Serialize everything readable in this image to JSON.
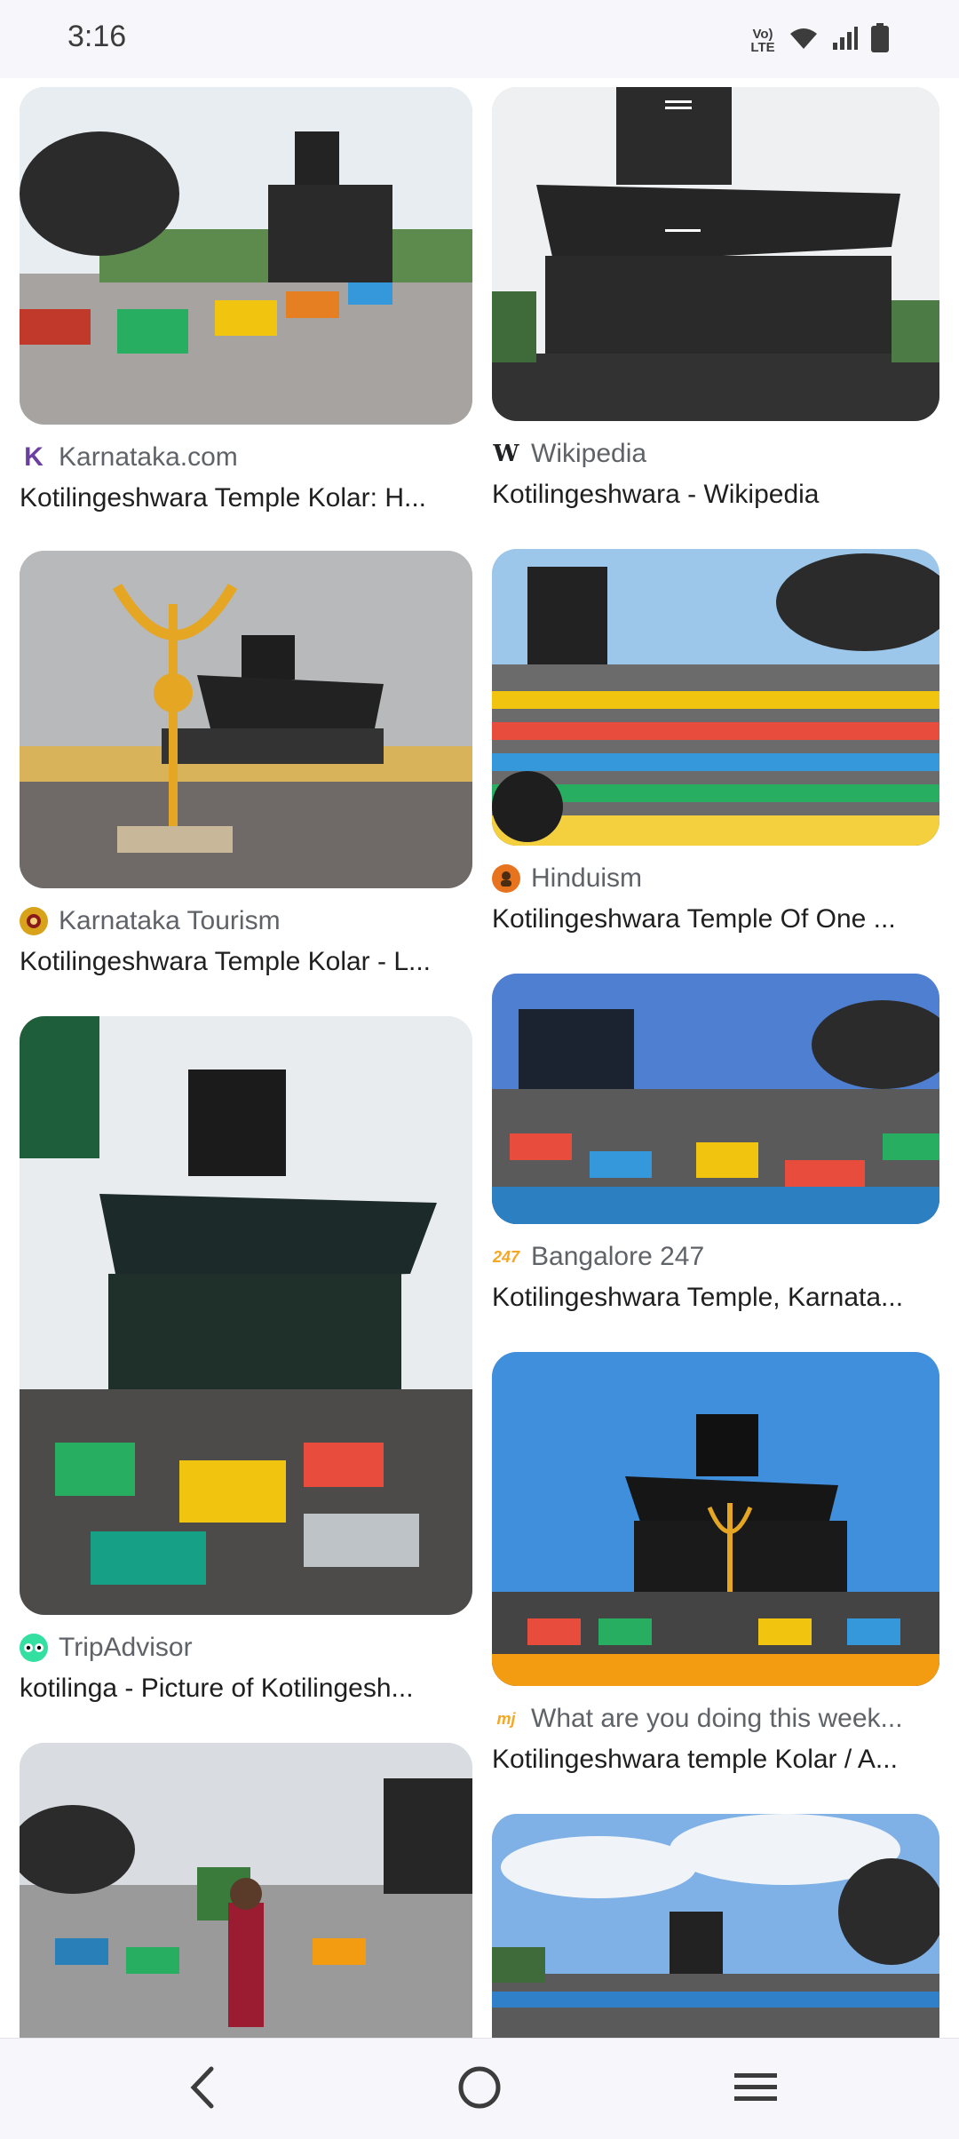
{
  "status_bar": {
    "time": "3:16",
    "volte_label": "Vo) LTE",
    "icons": [
      "volte-icon",
      "wifi-icon",
      "signal-icon",
      "battery-icon"
    ]
  },
  "results": {
    "left_column": [
      {
        "source": "Karnataka.com",
        "favicon": "K",
        "favicon_color": "#6b3fa0",
        "title": "Kotilingeshwara Temple Kolar: H..."
      },
      {
        "source": "Karnataka Tourism",
        "favicon": "emblem",
        "favicon_color": "#d9a21b",
        "title": "Kotilingeshwara Temple Kolar - L..."
      },
      {
        "source": "TripAdvisor",
        "favicon": "owl",
        "favicon_color": "#34e0a1",
        "title": "kotilinga - Picture of Kotilingesh..."
      },
      {
        "source": "",
        "favicon": "",
        "favicon_color": "",
        "title": ""
      }
    ],
    "right_column": [
      {
        "source": "Wikipedia",
        "favicon": "W",
        "favicon_color": "#202122",
        "title": "Kotilingeshwara - Wikipedia"
      },
      {
        "source": "Hinduism",
        "favicon": "H",
        "favicon_color": "#e8731e",
        "title": "Kotilingeshwara Temple Of One ..."
      },
      {
        "source": "Bangalore 247",
        "favicon": "247",
        "favicon_color": "#f5a623",
        "title": "Kotilingeshwara Temple, Karnata..."
      },
      {
        "source": "What are you doing this week...",
        "favicon": "mj",
        "favicon_color": "#f5a623",
        "title": "Kotilingeshwara temple Kolar / A..."
      },
      {
        "source": "",
        "favicon": "",
        "favicon_color": "",
        "title": ""
      }
    ]
  },
  "nav_bar": {
    "icons": [
      "back-icon",
      "home-icon",
      "recents-icon"
    ]
  }
}
